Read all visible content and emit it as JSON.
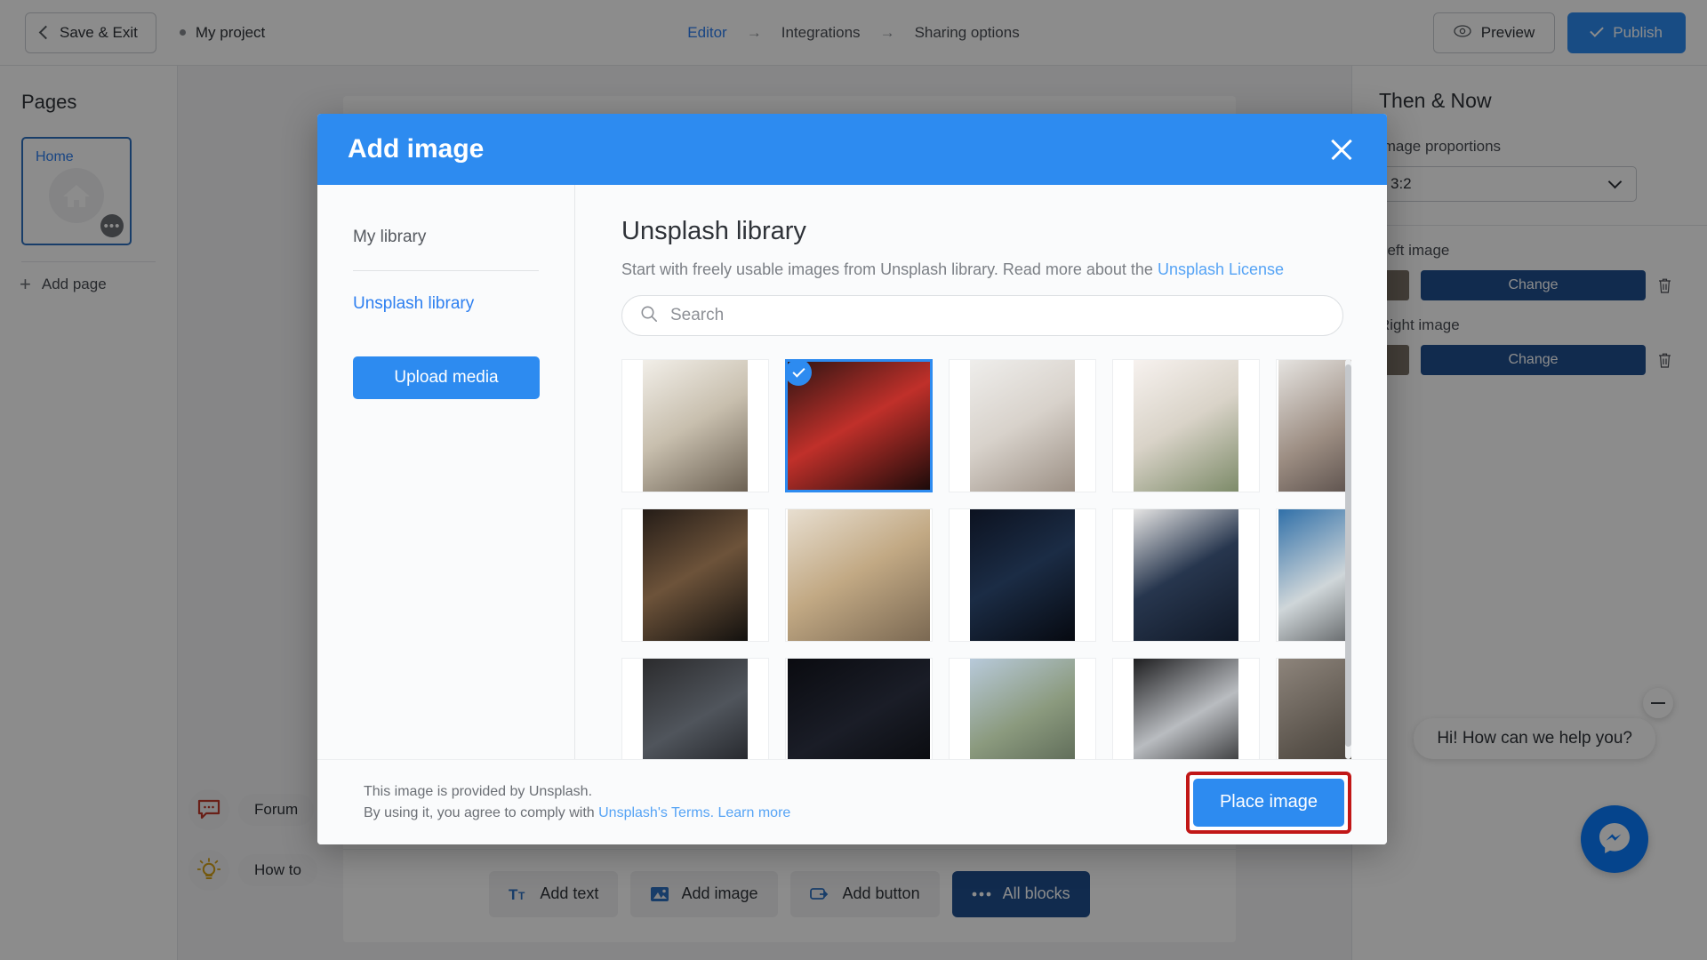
{
  "topbar": {
    "save_exit": "Save & Exit",
    "project_name": "My project",
    "breadcrumbs": [
      {
        "label": "Editor",
        "active": true
      },
      {
        "label": "Integrations",
        "active": false
      },
      {
        "label": "Sharing options",
        "active": false
      }
    ],
    "arrow": "→",
    "preview": "Preview",
    "publish": "Publish",
    "icons": {
      "eye": "eye-icon",
      "check": "check-icon",
      "chevron_left": "chevron-left-icon"
    }
  },
  "pages_panel": {
    "title": "Pages",
    "page_card": {
      "label": "Home",
      "menu": "•••"
    },
    "add_page": "Add page"
  },
  "block_toolbar": {
    "buttons": [
      {
        "label": "Add text",
        "icon": "text-icon",
        "primary": false
      },
      {
        "label": "Add image",
        "icon": "image-icon",
        "primary": false
      },
      {
        "label": "Add button",
        "icon": "button-icon",
        "primary": false
      },
      {
        "label": "All blocks",
        "icon": "dots-icon",
        "primary": true
      }
    ]
  },
  "props_panel": {
    "title": "Then & Now",
    "proportions_label": "Image proportions",
    "proportions_value": "3:2",
    "proportions_options": [
      "3:2"
    ],
    "left_image_label": "Left image",
    "right_image_label": "Right image",
    "change_label": "Change",
    "delete_icon": "trash-icon"
  },
  "help": {
    "forum": "Forum",
    "how_to": "How to",
    "forum_icon": "chat-bubble-icon",
    "how_to_icon": "lightbulb-icon"
  },
  "chat": {
    "greeting": "Hi! How can we help you?",
    "minimize_icon": "minimize-icon",
    "fab_icon": "messenger-icon"
  },
  "modal": {
    "title": "Add image",
    "close_icon": "close-icon",
    "sidebar": {
      "my_library": "My library",
      "unsplash_library": "Unsplash library",
      "upload_media": "Upload media"
    },
    "main": {
      "heading": "Unsplash library",
      "description_prefix": "Start with freely usable images from Unsplash library. Read more about the ",
      "description_link": "Unsplash License",
      "search_placeholder": "Search",
      "search_value": "",
      "search_icon": "search-icon",
      "selected_index": 1,
      "images": [
        {
          "alt": "desk-with-laptop-and-book",
          "c1": "#f2efe9",
          "c2": "#c8bfae",
          "c3": "#6b6052"
        },
        {
          "alt": "woman-in-red-light",
          "c1": "#2a1412",
          "c2": "#c0302a",
          "c3": "#180a09"
        },
        {
          "alt": "woman-in-white-coat",
          "c1": "#efeeec",
          "c2": "#d8d2cb",
          "c3": "#9b8f84"
        },
        {
          "alt": "hand-with-flowers",
          "c1": "#f7f2ef",
          "c2": "#d9d3c8",
          "c3": "#7c8a68"
        },
        {
          "alt": "portrait-white-shirt",
          "c1": "#e6e4e1",
          "c2": "#9c8d82",
          "c3": "#3a3130"
        },
        {
          "alt": "person-working-at-desk",
          "c1": "#241c17",
          "c2": "#6d533a",
          "c3": "#12100e"
        },
        {
          "alt": "sunlit-office-interior",
          "c1": "#e8dfd1",
          "c2": "#c2a984",
          "c3": "#7a6852"
        },
        {
          "alt": "night-sky-over-water",
          "c1": "#0c1220",
          "c2": "#1b2c45",
          "c3": "#060910"
        },
        {
          "alt": "wrist-watch-closeup",
          "c1": "#e7e6e5",
          "c2": "#27364e",
          "c3": "#101826"
        },
        {
          "alt": "skateboarder-on-street",
          "c1": "#2f6fa8",
          "c2": "#cfd6d9",
          "c3": "#2a2b2d"
        },
        {
          "alt": "person-at-monitor-setup",
          "c1": "#2b2b2d",
          "c2": "#50555c",
          "c3": "#15161a"
        },
        {
          "alt": "milky-way-silhouette",
          "c1": "#0a0b10",
          "c2": "#1a1d27",
          "c3": "#050608"
        },
        {
          "alt": "road-through-trees",
          "c1": "#b8cadb",
          "c2": "#8b9a7e",
          "c3": "#4e5a4a"
        },
        {
          "alt": "black-and-white-swans",
          "c1": "#1d1d1f",
          "c2": "#b9bcc0",
          "c3": "#0a0a0b"
        },
        {
          "alt": "blurred-portrait",
          "c1": "#8e857c",
          "c2": "#5b544c",
          "c3": "#2c2925"
        }
      ]
    },
    "footer": {
      "line1": "This image is provided by Unsplash.",
      "line2_prefix": "By using it, you agree to comply with ",
      "line2_link": "Unsplash's Terms. Learn more",
      "place_image": "Place image"
    }
  },
  "colors": {
    "accent_blue": "#2d8bf0",
    "dark_blue": "#1f4f8f",
    "highlight_red": "#c11717",
    "link_blue": "#55a3f5"
  }
}
